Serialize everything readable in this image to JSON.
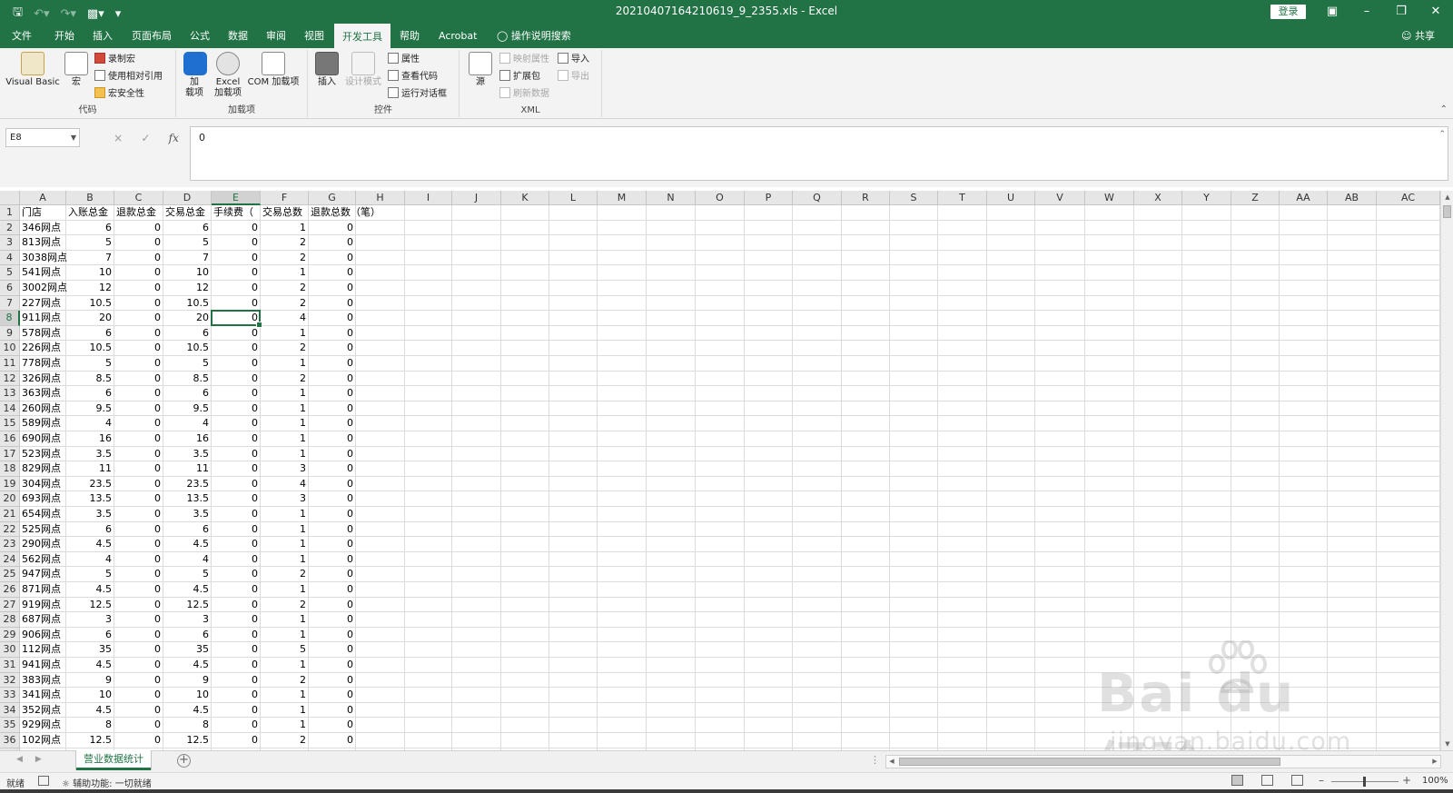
{
  "window": {
    "filename": "20210407164210619_9_2355.xls",
    "separator": " - ",
    "app": "Excel",
    "login": "登录",
    "quick_access": [
      "save-icon",
      "undo-icon",
      "redo-icon",
      "print-preview-icon",
      "customize-icon"
    ],
    "controls": [
      "ribbon-display-icon",
      "minimize-icon",
      "restore-icon",
      "close-icon"
    ]
  },
  "ribbon_tabs": [
    "文件",
    "开始",
    "插入",
    "页面布局",
    "公式",
    "数据",
    "审阅",
    "视图",
    "开发工具",
    "帮助",
    "Acrobat",
    "操作说明搜索"
  ],
  "active_tab": "开发工具",
  "share": "共享",
  "groups": {
    "code": {
      "label": "代码",
      "visual_basic": "Visual Basic",
      "macros": "宏",
      "record_macro": "录制宏",
      "relative_ref": "使用相对引用",
      "macro_security": "宏安全性"
    },
    "addins": {
      "label": "加载项",
      "addins_l1": "加",
      "addins_l2": "载项",
      "excel_addins_l1": "Excel",
      "excel_addins_l2": "加载项",
      "com_addins": "COM 加载项"
    },
    "controls": {
      "label": "控件",
      "insert": "插入",
      "design_mode": "设计模式",
      "properties": "属性",
      "view_code": "查看代码",
      "run_dialog": "运行对话框"
    },
    "xml": {
      "label": "XML",
      "source": "源",
      "map_props": "映射属性",
      "expansion_packs": "扩展包",
      "refresh_data": "刷新数据",
      "import": "导入",
      "export": "导出"
    }
  },
  "formula_bar": {
    "name_box": "E8",
    "cancel": "×",
    "enter": "✓",
    "fx": "fx",
    "value": "0"
  },
  "columns": [
    "A",
    "B",
    "C",
    "D",
    "E",
    "F",
    "G",
    "H",
    "I",
    "J",
    "K",
    "L",
    "M",
    "N",
    "O",
    "P",
    "Q",
    "R",
    "S",
    "T",
    "U",
    "V",
    "W",
    "X",
    "Y",
    "Z",
    "AA",
    "AB",
    "AC"
  ],
  "header_row": [
    "门店",
    "入账总金",
    "退款总金",
    "交易总金",
    "手续费（",
    "交易总数",
    "退款总数（笔）"
  ],
  "rows": [
    [
      "346网点",
      "6",
      "0",
      "6",
      "0",
      "1",
      "0"
    ],
    [
      "813网点",
      "5",
      "0",
      "5",
      "0",
      "2",
      "0"
    ],
    [
      "3038网点",
      "7",
      "0",
      "7",
      "0",
      "2",
      "0"
    ],
    [
      "541网点",
      "10",
      "0",
      "10",
      "0",
      "1",
      "0"
    ],
    [
      "3002网点",
      "12",
      "0",
      "12",
      "0",
      "2",
      "0"
    ],
    [
      "227网点",
      "10.5",
      "0",
      "10.5",
      "0",
      "2",
      "0"
    ],
    [
      "911网点",
      "20",
      "0",
      "20",
      "0",
      "4",
      "0"
    ],
    [
      "578网点",
      "6",
      "0",
      "6",
      "0",
      "1",
      "0"
    ],
    [
      "226网点",
      "10.5",
      "0",
      "10.5",
      "0",
      "2",
      "0"
    ],
    [
      "778网点",
      "5",
      "0",
      "5",
      "0",
      "1",
      "0"
    ],
    [
      "326网点",
      "8.5",
      "0",
      "8.5",
      "0",
      "2",
      "0"
    ],
    [
      "363网点",
      "6",
      "0",
      "6",
      "0",
      "1",
      "0"
    ],
    [
      "260网点",
      "9.5",
      "0",
      "9.5",
      "0",
      "1",
      "0"
    ],
    [
      "589网点",
      "4",
      "0",
      "4",
      "0",
      "1",
      "0"
    ],
    [
      "690网点",
      "16",
      "0",
      "16",
      "0",
      "1",
      "0"
    ],
    [
      "523网点",
      "3.5",
      "0",
      "3.5",
      "0",
      "1",
      "0"
    ],
    [
      "829网点",
      "11",
      "0",
      "11",
      "0",
      "3",
      "0"
    ],
    [
      "304网点",
      "23.5",
      "0",
      "23.5",
      "0",
      "4",
      "0"
    ],
    [
      "693网点",
      "13.5",
      "0",
      "13.5",
      "0",
      "3",
      "0"
    ],
    [
      "654网点",
      "3.5",
      "0",
      "3.5",
      "0",
      "1",
      "0"
    ],
    [
      "525网点",
      "6",
      "0",
      "6",
      "0",
      "1",
      "0"
    ],
    [
      "290网点",
      "4.5",
      "0",
      "4.5",
      "0",
      "1",
      "0"
    ],
    [
      "562网点",
      "4",
      "0",
      "4",
      "0",
      "1",
      "0"
    ],
    [
      "947网点",
      "5",
      "0",
      "5",
      "0",
      "2",
      "0"
    ],
    [
      "871网点",
      "4.5",
      "0",
      "4.5",
      "0",
      "1",
      "0"
    ],
    [
      "919网点",
      "12.5",
      "0",
      "12.5",
      "0",
      "2",
      "0"
    ],
    [
      "687网点",
      "3",
      "0",
      "3",
      "0",
      "1",
      "0"
    ],
    [
      "906网点",
      "6",
      "0",
      "6",
      "0",
      "1",
      "0"
    ],
    [
      "112网点",
      "35",
      "0",
      "35",
      "0",
      "5",
      "0"
    ],
    [
      "941网点",
      "4.5",
      "0",
      "4.5",
      "0",
      "1",
      "0"
    ],
    [
      "383网点",
      "9",
      "0",
      "9",
      "0",
      "2",
      "0"
    ],
    [
      "341网点",
      "10",
      "0",
      "10",
      "0",
      "1",
      "0"
    ],
    [
      "352网点",
      "4.5",
      "0",
      "4.5",
      "0",
      "1",
      "0"
    ],
    [
      "929网点",
      "8",
      "0",
      "8",
      "0",
      "1",
      "0"
    ],
    [
      "102网点",
      "12.5",
      "0",
      "12.5",
      "0",
      "2",
      "0"
    ]
  ],
  "active_cell": "E8",
  "sheet_tab": "营业数据统计",
  "status": {
    "ready": "就绪",
    "accessibility": "辅助功能: 一切就绪",
    "zoom": "100%"
  },
  "watermark": {
    "line1": "Bai du 经验",
    "line2": "jingyan.baidu.com"
  },
  "colors": {
    "excel_green": "#217346",
    "ribbon_bg": "#f3f3f3"
  }
}
